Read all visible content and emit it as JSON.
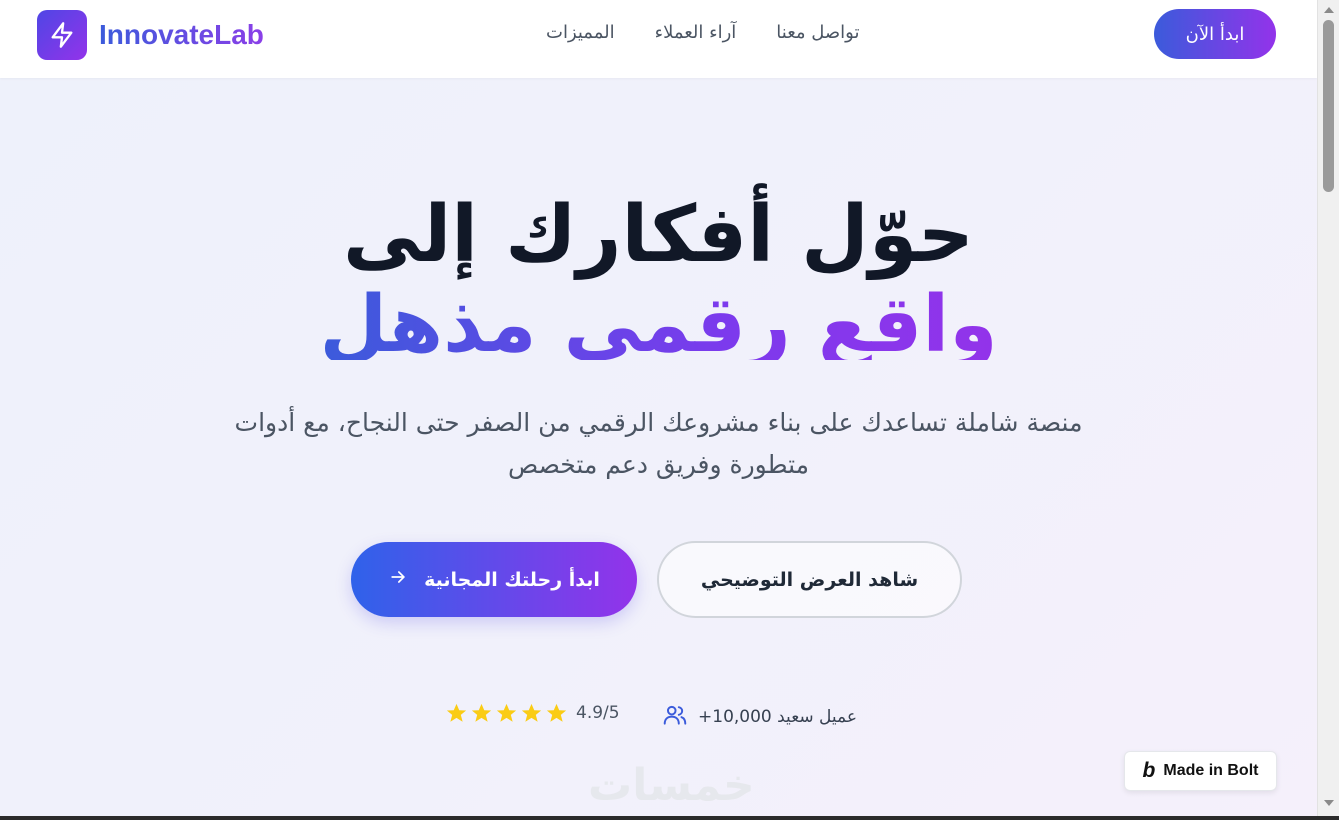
{
  "brand": {
    "name": "InnovateLab",
    "logo_icon": "lightning-bolt-icon"
  },
  "nav": {
    "links": [
      {
        "label": "تواصل معنا"
      },
      {
        "label": "آراء العملاء"
      },
      {
        "label": "المميزات"
      }
    ],
    "cta_label": "ابدأ الآن"
  },
  "hero": {
    "title_line1": "حوّل أفكارك إلى",
    "title_line2": "واقع رقمي مذهل",
    "subtitle": "منصة شاملة تساعدك على بناء مشروعك الرقمي من الصفر حتى النجاح، مع أدوات متطورة وفريق دعم متخصص",
    "primary_button": "ابدأ رحلتك المجانية",
    "secondary_button": "شاهد العرض التوضيحي"
  },
  "stats": {
    "customers": "عميل سعيد 10,000+",
    "rating_text": "4.9/5",
    "stars": 5
  },
  "watermark": "خمسات",
  "badge": {
    "label": "Made in Bolt",
    "icon": "bolt-b-icon"
  },
  "colors": {
    "accent_start": "#3b5bdb",
    "accent_end": "#9333ea",
    "star": "#facc15"
  }
}
